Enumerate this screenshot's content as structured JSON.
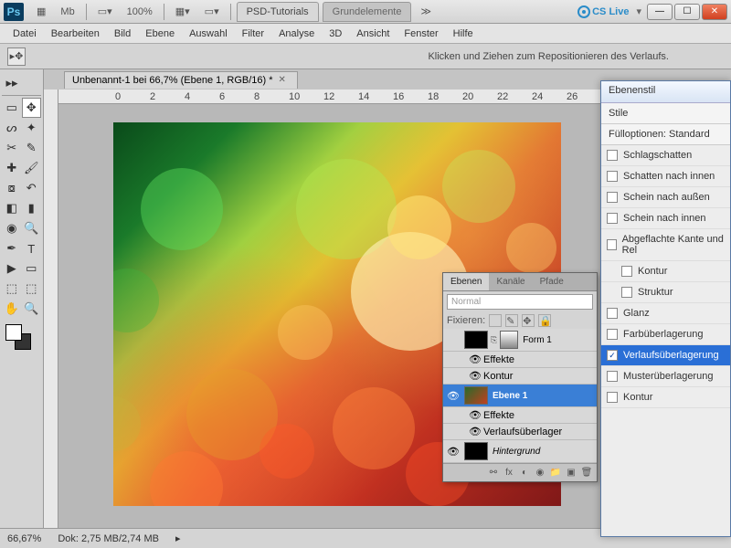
{
  "titlebar": {
    "zoom_label": "100%",
    "tabs": [
      "PSD-Tutorials",
      "Grundelemente"
    ],
    "cslive": "CS Live"
  },
  "menu": [
    "Datei",
    "Bearbeiten",
    "Bild",
    "Ebene",
    "Auswahl",
    "Filter",
    "Analyse",
    "3D",
    "Ansicht",
    "Fenster",
    "Hilfe"
  ],
  "optbar": {
    "hint": "Klicken und Ziehen zum Repositionieren des Verlaufs."
  },
  "doctab": {
    "title": "Unbenannt-1 bei 66,7% (Ebene 1, RGB/16) *"
  },
  "ruler_ticks": [
    "0",
    "2",
    "4",
    "6",
    "8",
    "10",
    "12",
    "14",
    "16",
    "18",
    "20",
    "22",
    "24",
    "26"
  ],
  "statusbar": {
    "zoom": "66,67%",
    "doc": "Dok: 2,75 MB/2,74 MB"
  },
  "layers_panel": {
    "tabs": [
      "Ebenen",
      "Kanäle",
      "Pfade"
    ],
    "blend_mode": "Normal",
    "lock_label": "Fixieren:",
    "layers": [
      {
        "name": "Form 1",
        "effects_label": "Effekte",
        "sub_effect": "Kontur"
      },
      {
        "name": "Ebene 1",
        "effects_label": "Effekte",
        "sub_effect": "Verlaufsüberlager"
      },
      {
        "name": "Hintergrund",
        "italic": true
      }
    ]
  },
  "layer_style": {
    "title": "Ebenenstil",
    "styles_header": "Stile",
    "fill_header": "Fülloptionen: Standard",
    "items": [
      {
        "label": "Schlagschatten",
        "checked": false
      },
      {
        "label": "Schatten nach innen",
        "checked": false
      },
      {
        "label": "Schein nach außen",
        "checked": false
      },
      {
        "label": "Schein nach innen",
        "checked": false
      },
      {
        "label": "Abgeflachte Kante und Rel",
        "checked": false
      },
      {
        "label": "Kontur",
        "checked": false,
        "sub": true
      },
      {
        "label": "Struktur",
        "checked": false,
        "sub": true
      },
      {
        "label": "Glanz",
        "checked": false
      },
      {
        "label": "Farbüberlagerung",
        "checked": false
      },
      {
        "label": "Verlaufsüberlagerung",
        "checked": true,
        "selected": true
      },
      {
        "label": "Musterüberlagerung",
        "checked": false
      },
      {
        "label": "Kontur",
        "checked": false
      }
    ]
  }
}
